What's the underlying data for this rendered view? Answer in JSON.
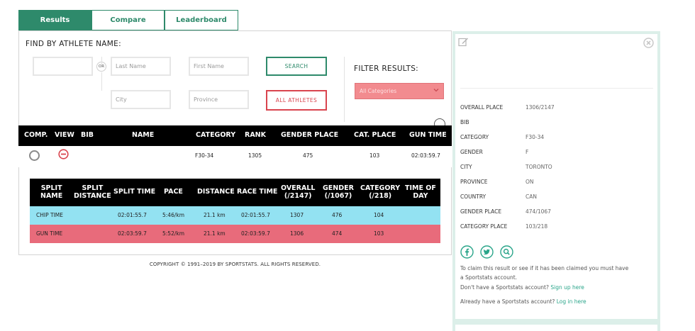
{
  "tabs": [
    {
      "label": "Results",
      "active": true
    },
    {
      "label": "Compare",
      "active": false
    },
    {
      "label": "Leaderboard",
      "active": false
    }
  ],
  "search": {
    "title": "FIND BY ATHLETE NAME:",
    "or_label": "OR",
    "last_name_placeholder": "Last Name",
    "first_name_placeholder": "First Name",
    "city_placeholder": "City",
    "province_placeholder": "Province",
    "search_button": "SEARCH",
    "all_athletes_button": "ALL ATHLETES"
  },
  "filter": {
    "title": "FILTER RESULTS:",
    "selected": "All Categories"
  },
  "results_table": {
    "headers": [
      "COMP.",
      "VIEW",
      "BIB",
      "NAME",
      "CATEGORY",
      "RANK",
      "GENDER PLACE",
      "CAT. PLACE",
      "GUN TIME"
    ],
    "row": {
      "bib": "",
      "name": "",
      "category": "F30-34",
      "rank": "1305",
      "gender_place": "475",
      "cat_place": "103",
      "gun_time": "02:03:59.7"
    }
  },
  "splits_table": {
    "headers": {
      "split_name": [
        "SPLIT",
        "NAME"
      ],
      "split_distance": [
        "SPLIT",
        "DISTANCE"
      ],
      "split_time": "SPLIT TIME",
      "pace": "PACE",
      "distance": "DISTANCE",
      "race_time": "RACE TIME",
      "overall": [
        "OVERALL",
        "(/2147)"
      ],
      "gender": [
        "GENDER",
        "(/1067)"
      ],
      "category": [
        "CATEGORY",
        "(/218)"
      ],
      "time_of_day": [
        "TIME OF",
        "DAY"
      ]
    },
    "rows": [
      {
        "name": "CHIP TIME",
        "split_time": "02:01:55.7",
        "pace": "5:46/km",
        "distance": "21.1 km",
        "race_time": "02:01:55.7",
        "overall": "1307",
        "gender": "476",
        "category": "104",
        "color": "#93e2f2"
      },
      {
        "name": "GUN TIME",
        "split_time": "02:03:59.7",
        "pace": "5:52/km",
        "distance": "21.1 km",
        "race_time": "02:03:59.7",
        "overall": "1306",
        "gender": "474",
        "category": "103",
        "color": "#e86b7b"
      }
    ]
  },
  "copyright": "COPYRIGHT © 1991–2019 BY SPORTSTATS. ALL RIGHTS RESERVED.",
  "details": {
    "rows": [
      {
        "label": "OVERALL PLACE",
        "value": "1306/2147"
      },
      {
        "label": "BIB",
        "value": ""
      },
      {
        "label": "CATEGORY",
        "value": "F30-34"
      },
      {
        "label": "GENDER",
        "value": "F"
      },
      {
        "label": "CITY",
        "value": "TORONTO"
      },
      {
        "label": "PROVINCE",
        "value": "ON"
      },
      {
        "label": "COUNTRY",
        "value": "CAN"
      },
      {
        "label": "GENDER PLACE",
        "value": "474/1067"
      },
      {
        "label": "CATEGORY PLACE",
        "value": "103/218"
      }
    ],
    "claim_line1": "To claim this result or see if it has been claimed you must have",
    "claim_line2": "a Sportstats account.",
    "signup_prefix": "Don't have a Sportstats account?",
    "signup_link": "Sign up here",
    "login_prefix": "Already have a Sportstats account?",
    "login_link": "Log in here"
  },
  "colors": {
    "brand_green": "#2e8a6b",
    "alert_red": "#d9444e",
    "chip_row": "#93e2f2",
    "gun_row": "#e86b7b",
    "link": "#2aa58a"
  }
}
